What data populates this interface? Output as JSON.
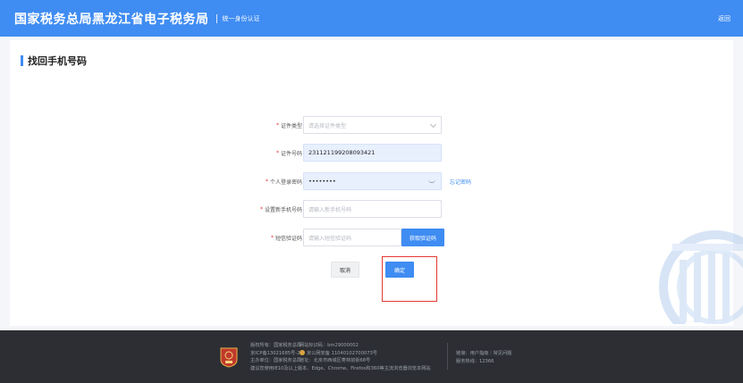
{
  "header": {
    "brand": "国家税务总局黑龙江省电子税务局",
    "subtitle": "统一身份认证",
    "right_link": "返回",
    "color": "#3f8cf2"
  },
  "page": {
    "section_title": "找回手机号码"
  },
  "form": {
    "id_type": {
      "label": "证件类型",
      "placeholder": "请选择证件类型"
    },
    "id_number": {
      "label": "证件号码",
      "value": "231121199208093421"
    },
    "password": {
      "label": "个人登录密码",
      "value": "••••••••",
      "forgot_link": "忘记密码"
    },
    "new_phone": {
      "label": "设置新手机号码",
      "placeholder": "请输入新手机号码"
    },
    "sms_code": {
      "label": "短信验证码",
      "placeholder": "请输入短信验证码",
      "button": "获取验证码"
    },
    "required_mark": "*",
    "cancel": "取消",
    "confirm": "确定"
  },
  "footer": {
    "col1": [
      "版权所有：国家税务总局",
      "京ICP备13021685号-2",
      "主办单位：国家税务总局"
    ],
    "col2": [
      "网站标识码：bm29000002",
      "京公网安备 11040102700073号",
      "地址：北京市西城区枣林前街68号"
    ],
    "notice": "建议您使用IE10及以上版本、Edge、Chrome、Firefox和360等主流浏览器浏览本网站",
    "col3": [
      "链接：用户指南｜常见问题",
      "服务热线：12366"
    ],
    "background": "#2c2e33"
  }
}
